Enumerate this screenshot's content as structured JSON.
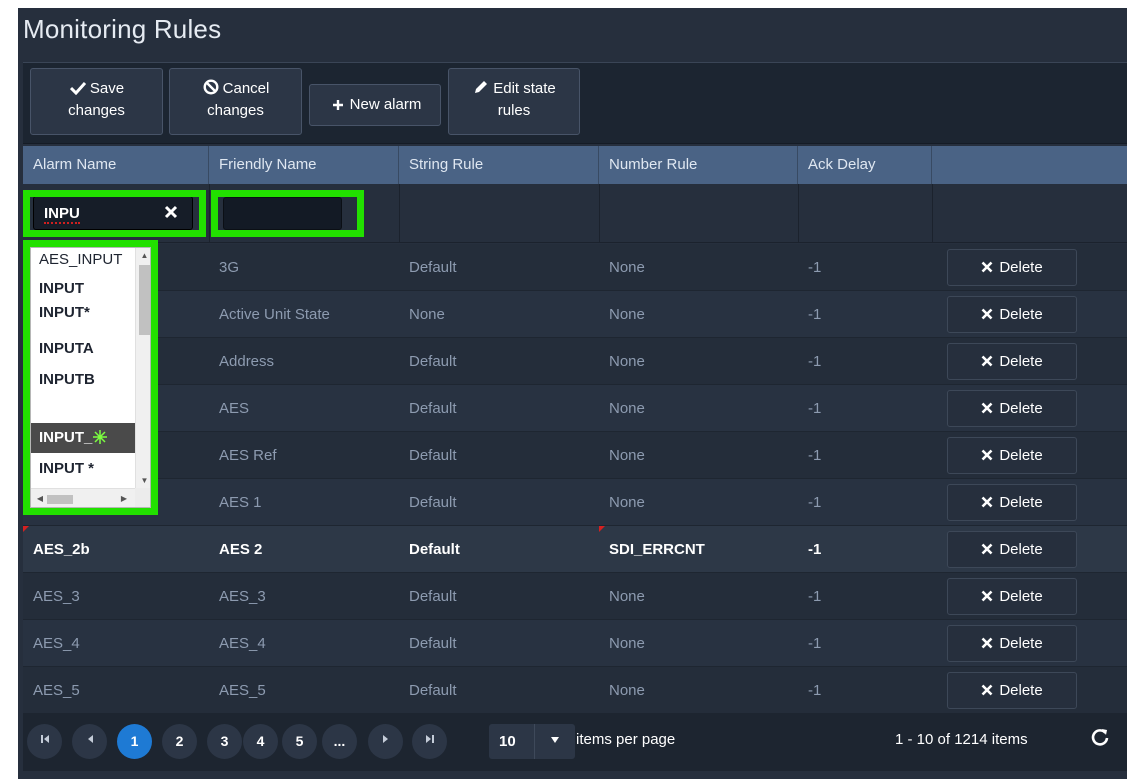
{
  "page": {
    "title": "Monitoring Rules"
  },
  "toolbar": {
    "save_line1": "Save",
    "save_line2": "changes",
    "cancel_line1": "Cancel",
    "cancel_line2": "changes",
    "new_alarm": "New alarm",
    "edit_line1": "Edit state",
    "edit_line2": "rules"
  },
  "columns": [
    "Alarm Name",
    "Friendly Name",
    "String Rule",
    "Number Rule",
    "Ack Delay",
    ""
  ],
  "filter": {
    "alarm_name_value": "INPU",
    "friendly_name_value": ""
  },
  "autocomplete": [
    "AES_INPUT",
    "INPUT",
    "INPUT*",
    "INPUTA",
    "INPUTB",
    "INPUT_",
    "INPUT *"
  ],
  "delete_label": "Delete",
  "rows": [
    {
      "alarm": "",
      "friendly": "3G",
      "string_rule": "Default",
      "number_rule": "None",
      "ack_delay": "-1"
    },
    {
      "alarm": "",
      "friendly": "Active Unit State",
      "string_rule": "None",
      "number_rule": "None",
      "ack_delay": "-1"
    },
    {
      "alarm": "",
      "friendly": "Address",
      "string_rule": "Default",
      "number_rule": "None",
      "ack_delay": "-1"
    },
    {
      "alarm": "",
      "friendly": "AES",
      "string_rule": "Default",
      "number_rule": "None",
      "ack_delay": "-1"
    },
    {
      "alarm": "",
      "friendly": "AES Ref",
      "string_rule": "Default",
      "number_rule": "None",
      "ack_delay": "-1"
    },
    {
      "alarm": "",
      "friendly": "AES 1",
      "string_rule": "Default",
      "number_rule": "None",
      "ack_delay": "-1"
    },
    {
      "alarm": "AES_2b",
      "friendly": "AES 2",
      "string_rule": "Default",
      "number_rule": "SDI_ERRCNT",
      "ack_delay": "-1"
    },
    {
      "alarm": "AES_3",
      "friendly": "AES_3",
      "string_rule": "Default",
      "number_rule": "None",
      "ack_delay": "-1"
    },
    {
      "alarm": "AES_4",
      "friendly": "AES_4",
      "string_rule": "Default",
      "number_rule": "None",
      "ack_delay": "-1"
    },
    {
      "alarm": "AES_5",
      "friendly": "AES_5",
      "string_rule": "Default",
      "number_rule": "None",
      "ack_delay": "-1"
    }
  ],
  "pager": {
    "pages": [
      "1",
      "2",
      "3",
      "4",
      "5",
      "..."
    ],
    "page_size": "10",
    "items_per_page": "items per page",
    "summary": "1 - 10 of 1214 items"
  },
  "colors": {
    "highlight": "#22e000",
    "active_page": "#1e7ad4",
    "header": "#4a6385"
  }
}
